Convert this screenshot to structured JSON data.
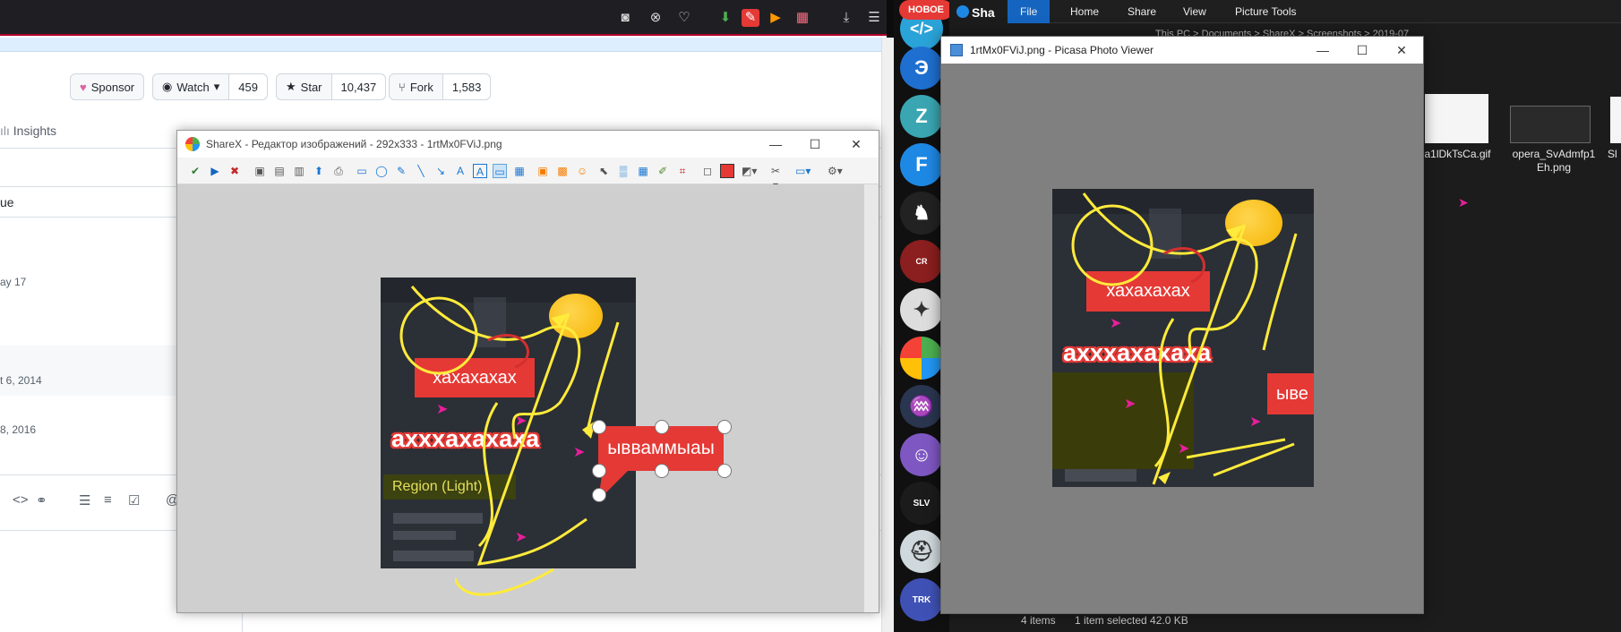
{
  "browser": {
    "sponsor_label": "Sponsor",
    "watch_label": "Watch",
    "watch_count": "459",
    "star_label": "Star",
    "star_count": "10,437",
    "fork_label": "Fork",
    "fork_count": "1,583",
    "insights_label": "Insights",
    "col_header_fragment": "ue",
    "dates": [
      "ay 17",
      "t 6, 2014",
      "8, 2016"
    ]
  },
  "sharex": {
    "title": "ShareX - Редактор изображений - 292x333 - 1rtMx0FViJ.png",
    "label_red": "хахахахах",
    "label_big": "ахххахахаха",
    "region_label": "Region (Light)",
    "speech_label": "ывваммыаы"
  },
  "picasa": {
    "title": "1rtMx0FViJ.png - Picasa Photo Viewer",
    "label_red": "хахахахах",
    "label_big": "ахххахахаха",
    "speech_partial": "ыве"
  },
  "dock": {
    "badge": "НОВОЕ",
    "app_title_fragment": "Sha"
  },
  "explorer": {
    "ribbon_tabs": [
      "File",
      "Home",
      "Share",
      "View",
      "Picture Tools"
    ],
    "path_fragment": "This PC > Documents > ShareX > Screenshots > 2019-07",
    "file1": "a1lDkTsCa.gif",
    "file2_line1": "opera_SvAdmfp1",
    "file2_line2": "Eh.png",
    "file3": "Sl",
    "status_items": "4 items",
    "status_selected": "1 item selected  42.0 KB"
  },
  "colors": {
    "accent_red": "#e53935",
    "annotation_yellow": "#ffeb3b",
    "cursor_magenta": "#e91e9c"
  }
}
